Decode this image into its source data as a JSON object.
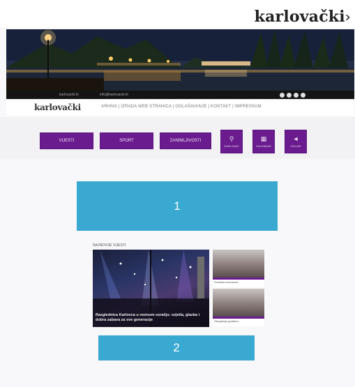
{
  "header": {
    "logo_text": "karlovački",
    "logo_arrow": "›"
  },
  "subbar": {
    "logo_text": "karlovački",
    "tagline": "ARHIVA | IZRADA WEB STRANICA | OGLAŠAVANJE | KONTAKT | IMPRESSUM"
  },
  "hero": {
    "strip_left": "karlovacki.hr",
    "strip_right": "info@karlovacki.hr",
    "social_icons": [
      "facebook-icon",
      "twitter-icon",
      "instagram-icon",
      "youtube-icon"
    ]
  },
  "nav": {
    "buttons": [
      "VIJESTI",
      "SPORT",
      "ZANIMLJIVOSTI"
    ],
    "square_buttons": [
      {
        "icon": "pin-icon",
        "glyph": "⚲",
        "label": "KARLOVAC"
      },
      {
        "icon": "calendar-icon",
        "glyph": "▦",
        "label": "KALENDAR"
      },
      {
        "icon": "megaphone-icon",
        "glyph": "◄",
        "label": "OGLASI"
      }
    ]
  },
  "ads": {
    "slot1": "1",
    "slot2": "2",
    "color": "#3aa9d1"
  },
  "news": {
    "section_label": "NAJNOVIJE VIJESTI",
    "main_caption": "Razglednica Karlovca u noćnom ozračju: svjetla, glazba i dobra zabava za sve generacije",
    "side_items": [
      {
        "caption": "Gradska svečanost"
      },
      {
        "caption": "Okupljanje građana"
      }
    ]
  },
  "colors": {
    "accent": "#6a1b8e",
    "ad_blue": "#3aa9d1"
  }
}
